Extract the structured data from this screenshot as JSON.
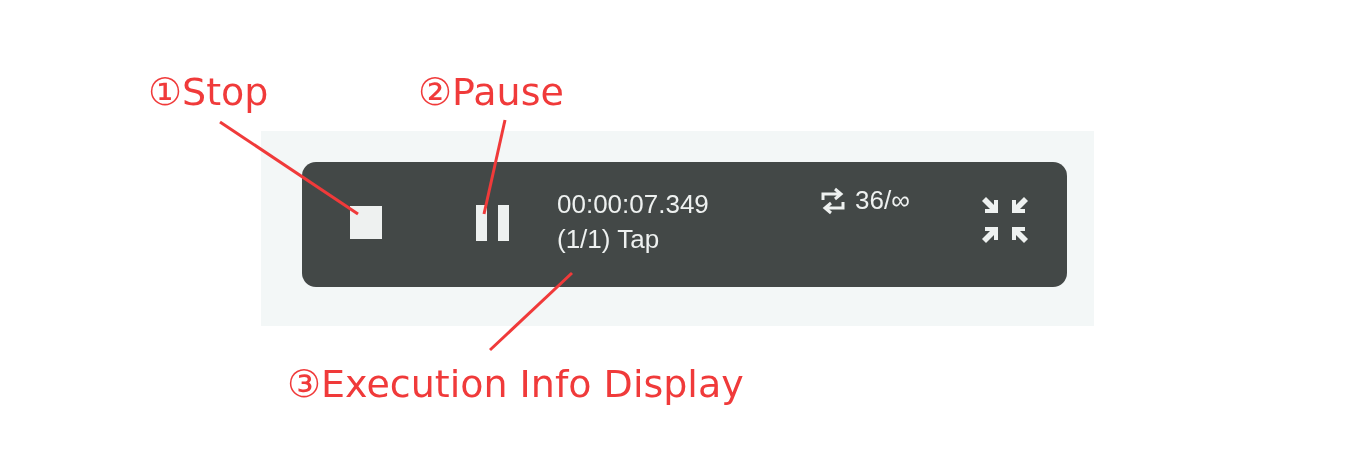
{
  "annotations": [
    {
      "label": "①Stop"
    },
    {
      "label": "②Pause"
    },
    {
      "label": "③Execution Info Display"
    }
  ],
  "player": {
    "elapsed": "00:00:07.349",
    "step": "(1/1) Tap",
    "repeat_count": "36/∞"
  }
}
